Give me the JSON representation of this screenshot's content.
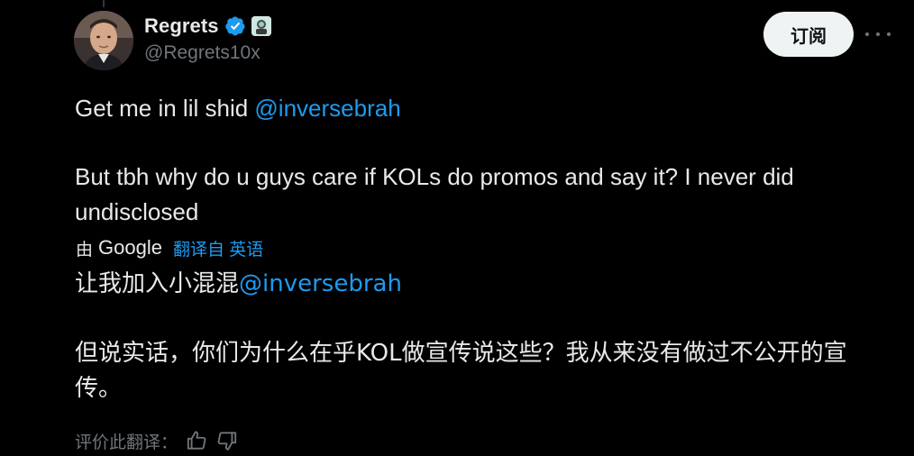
{
  "author": {
    "display_name": "Regrets",
    "handle": "@Regrets10x",
    "avatar_icon": "profile-photo",
    "verified_icon": "verified-badge-icon",
    "affiliate_badge_icon": "affiliate-badge-icon"
  },
  "actions": {
    "subscribe_label": "订阅",
    "more_icon": "more-horizontal-icon"
  },
  "tweet": {
    "line1_text": "Get me in lil shid ",
    "line1_mention": "@inversebrah",
    "line2_text": "But tbh why do u guys care if KOLs do promos and say it? I never did undisclosed"
  },
  "translation": {
    "by_label": "由",
    "provider": "Google",
    "link_label": "翻译自 英语",
    "line1_text": "让我加入小混混",
    "line1_mention": "@inversebrah",
    "line2_text": "但说实话，你们为什么在乎KOL做宣传说这些？我从来没有做过不公开的宣传。",
    "rate_label": "评价此翻译：",
    "thumbs_up_icon": "thumbs-up-icon",
    "thumbs_down_icon": "thumbs-down-icon"
  },
  "colors": {
    "background": "#000000",
    "text": "#e7e9ea",
    "secondary_text": "#71767b",
    "link": "#1d9bf0",
    "verified": "#1d9bf0",
    "button_bg": "#eff3f4"
  }
}
